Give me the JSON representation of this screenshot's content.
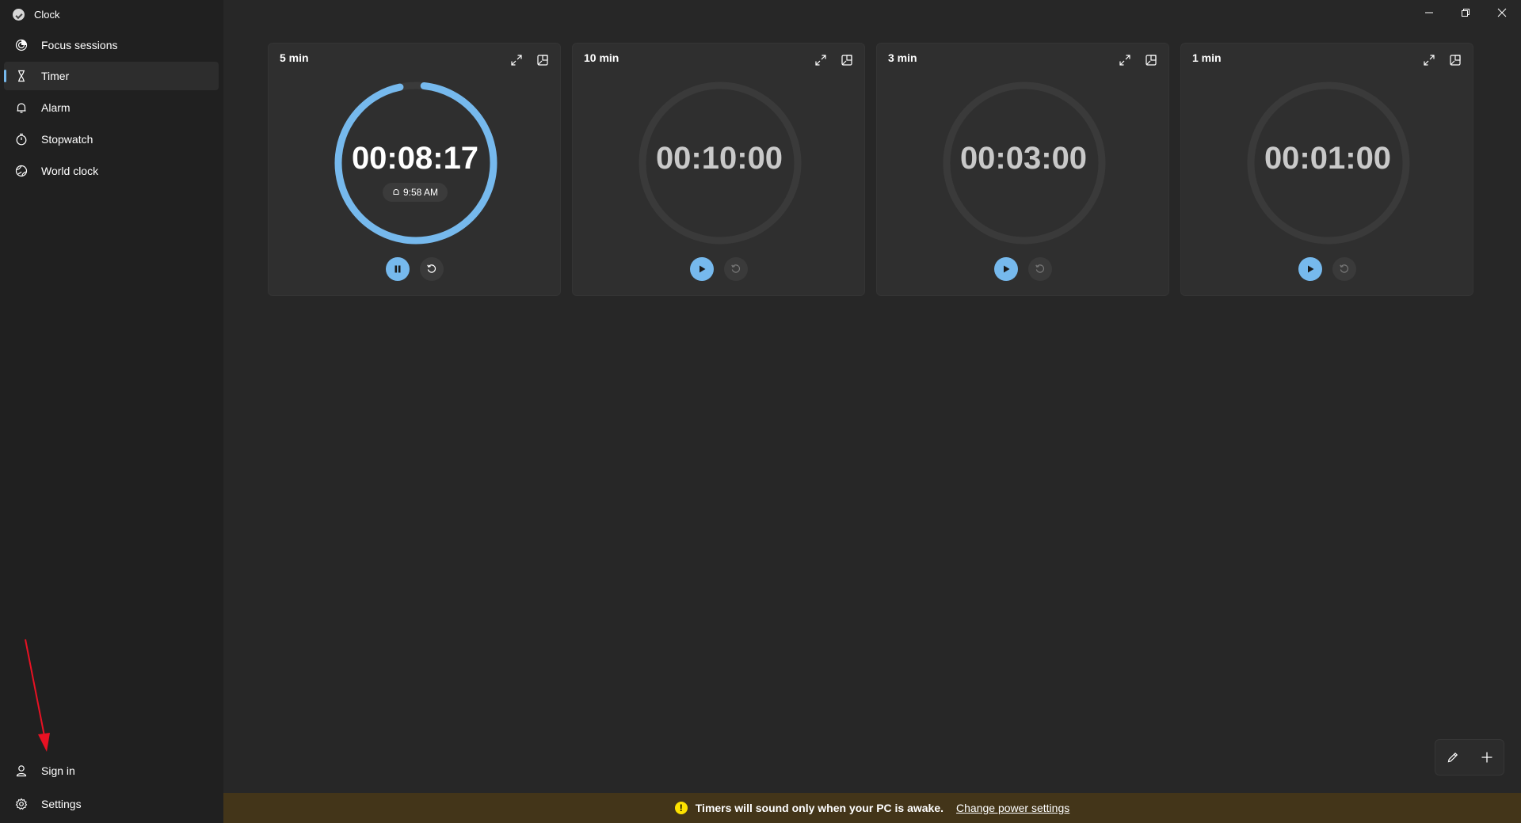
{
  "app": {
    "title": "Clock"
  },
  "colors": {
    "accent": "#76b9ed",
    "notice_bg": "#433519",
    "warning": "#fce100",
    "annotation": "#e81123"
  },
  "sidebar": {
    "items": [
      {
        "label": "Focus sessions",
        "icon": "focus-icon",
        "active": false
      },
      {
        "label": "Timer",
        "icon": "hourglass-icon",
        "active": true
      },
      {
        "label": "Alarm",
        "icon": "bell-icon",
        "active": false
      },
      {
        "label": "Stopwatch",
        "icon": "stopwatch-icon",
        "active": false
      },
      {
        "label": "World clock",
        "icon": "globe-icon",
        "active": false
      }
    ],
    "bottom": [
      {
        "label": "Sign in",
        "icon": "person-icon"
      },
      {
        "label": "Settings",
        "icon": "gear-icon"
      }
    ]
  },
  "timers": [
    {
      "name": "5 min",
      "time": "00:08:17",
      "running": true,
      "progress": 0.95,
      "end_time": "9:58 AM"
    },
    {
      "name": "10 min",
      "time": "00:10:00",
      "running": false,
      "progress": 0
    },
    {
      "name": "3 min",
      "time": "00:03:00",
      "running": false,
      "progress": 0
    },
    {
      "name": "1 min",
      "time": "00:01:00",
      "running": false,
      "progress": 0
    }
  ],
  "notice": {
    "message": "Timers will sound only when your PC is awake.",
    "link": "Change power settings"
  }
}
